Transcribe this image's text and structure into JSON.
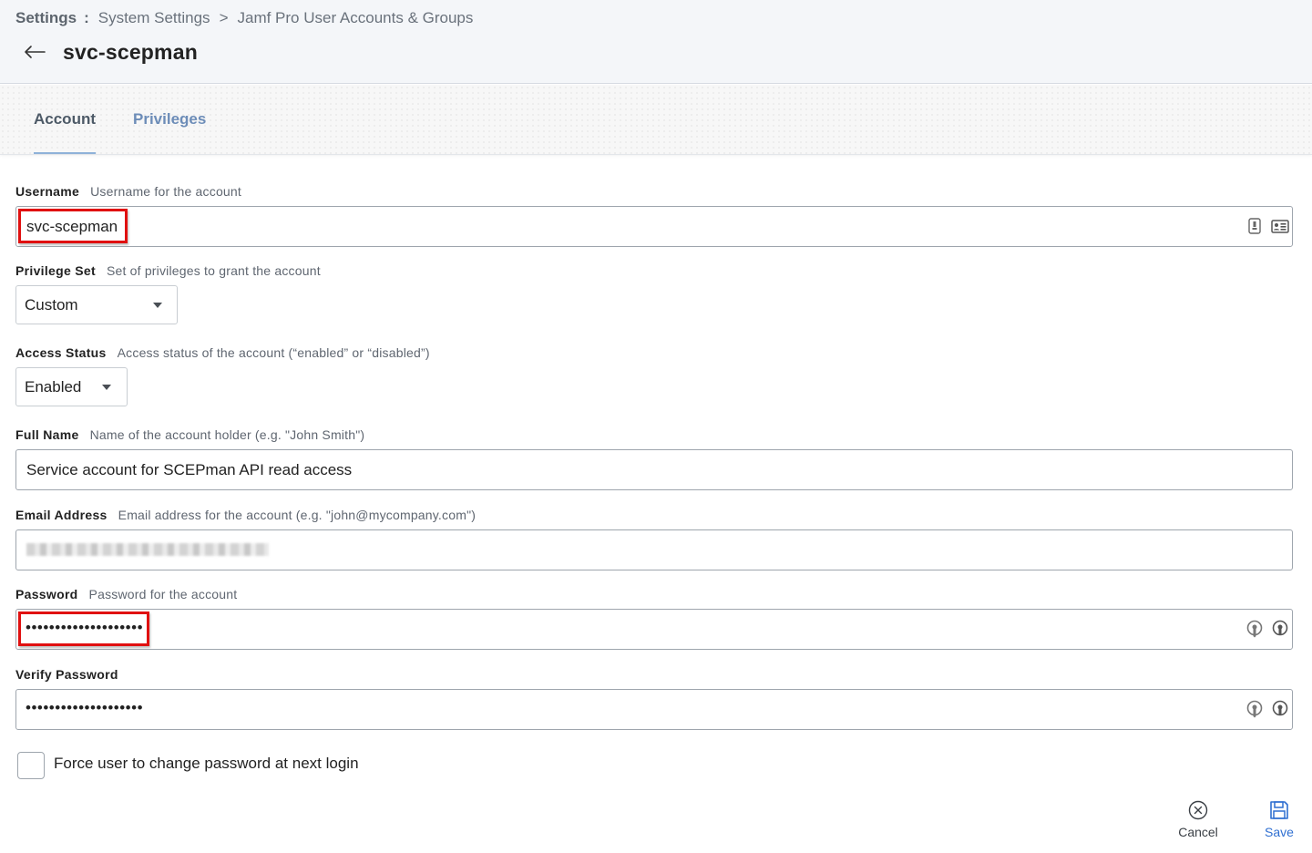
{
  "breadcrumb": {
    "root": "Settings",
    "separator_colon": ":",
    "level1": "System Settings",
    "separator": ">",
    "level2": "Jamf Pro User Accounts & Groups"
  },
  "page": {
    "title": "svc-scepman",
    "back_icon": "arrow-left-icon"
  },
  "tabs": [
    {
      "label": "Account",
      "active": true
    },
    {
      "label": "Privileges",
      "active": false
    }
  ],
  "form": {
    "username": {
      "label": "Username",
      "description": "Username for the account",
      "value": "svc-scepman"
    },
    "privilege_set": {
      "label": "Privilege Set",
      "description": "Set of privileges to grant the account",
      "value": "Custom"
    },
    "access_status": {
      "label": "Access Status",
      "description": "Access status of the account (“enabled” or “disabled”)",
      "value": "Enabled"
    },
    "full_name": {
      "label": "Full Name",
      "description": "Name of the account holder (e.g. \"John Smith\")",
      "value": "Service account for SCEPman API read access"
    },
    "email": {
      "label": "Email Address",
      "description": "Email address for the account (e.g. \"john@mycompany.com\")"
    },
    "password": {
      "label": "Password",
      "description": "Password for the account",
      "value": "••••••••••••••••••••"
    },
    "verify_password": {
      "label": "Verify Password",
      "value": "••••••••••••••••••••"
    },
    "force_change": {
      "label": "Force user to change password at next login",
      "checked": false
    }
  },
  "actions": {
    "cancel": {
      "label": "Cancel",
      "icon": "circle-x-icon"
    },
    "save": {
      "label": "Save",
      "icon": "floppy-disk-icon"
    }
  },
  "colors": {
    "highlight_border": "#e01010",
    "save_accent": "#2f6fd1",
    "tab_underline": "#8fb2d9",
    "header_bg": "#f4f6f9"
  }
}
